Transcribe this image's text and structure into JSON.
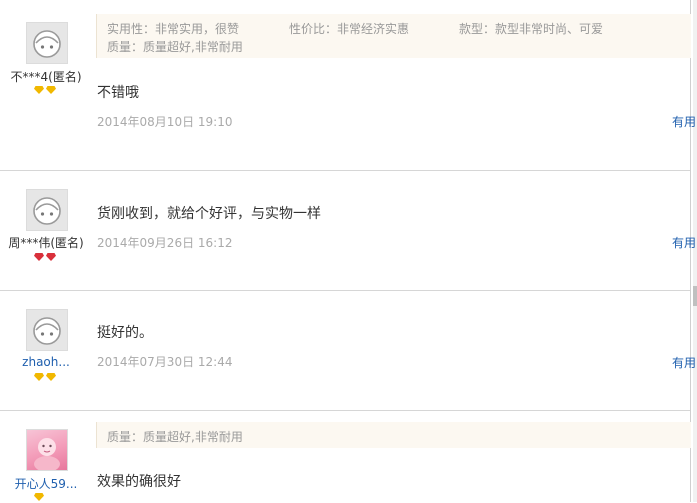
{
  "reviews": [
    {
      "user": "不***4(匿名)",
      "tags": [
        "实用性：非常实用，很赞",
        "性价比：非常经济实惠",
        "款型：款型非常时尚、可爱",
        "质量：质量超好,非常耐用"
      ],
      "content": "不错哦",
      "time": "2014年08月10日 19:10",
      "useful": "有用"
    },
    {
      "user": "周***伟(匿名)",
      "content": "货刚收到，就给个好评，与实物一样",
      "time": "2014年09月26日 16:12",
      "useful": "有用"
    },
    {
      "user": "zhaoh...",
      "content": "挺好的。",
      "time": "2014年07月30日 12:44",
      "useful": "有用"
    },
    {
      "user": "开心人59...",
      "tags": [
        "质量：质量超好,非常耐用"
      ],
      "content": "效果的确很好"
    }
  ],
  "icons": {
    "default_avatar": "default-avatar-icon",
    "level_gold": "gold-diamond-icon",
    "level_red": "red-heart-diamond-icon"
  },
  "colors": {
    "link": "#1f5fae",
    "tag_bg": "#fcf8f1",
    "gold": "#f1b800",
    "red": "#d9303b"
  }
}
